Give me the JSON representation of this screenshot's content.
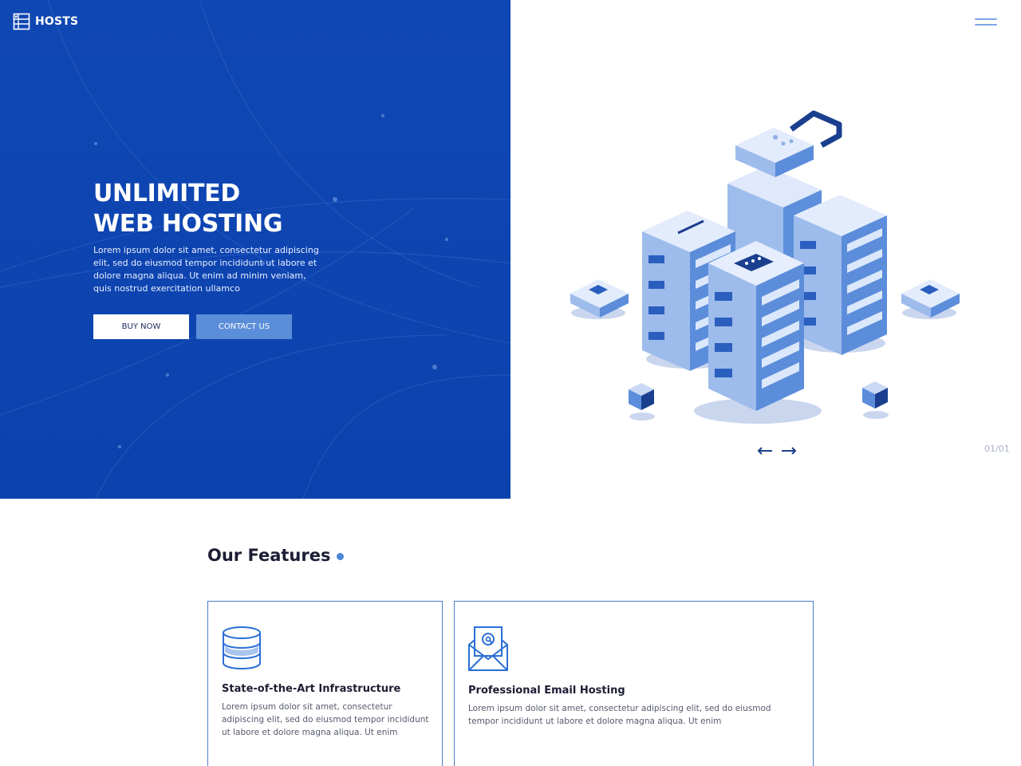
{
  "header": {
    "logo_text": "HOSTS",
    "logo_icon": "server-list-icon",
    "menu_icon": "hamburger-menu-icon"
  },
  "hero": {
    "title_line1": "UNLIMITED",
    "title_line2": "WEB HOSTING",
    "description": "Lorem ipsum dolor sit amet, consectetur adipiscing elit, sed do eiusmod tempor incididunt ut labore et dolore magna aliqua. Ut enim ad minim veniam, quis nostrud exercitation ullamco",
    "buy_label": "BUY NOW",
    "contact_label": "CONTACT US",
    "slide_counter": "01/01",
    "illustration": "isometric-server-racks-with-lock"
  },
  "features": {
    "heading": "Our Features",
    "cards": [
      {
        "icon": "database-icon",
        "title": "State-of-the-Art Infrastructure",
        "text": "Lorem ipsum dolor sit amet, consectetur adipiscing elit, sed do eiusmod tempor incididunt ut labore et dolore magna aliqua. Ut enim"
      },
      {
        "icon": "email-envelope-icon",
        "title": "Professional Email Hosting",
        "text": "Lorem ipsum dolor sit amet, consectetur adipiscing elit, sed do eiusmod tempor incididunt ut labore et dolore magna aliqua. Ut enim"
      }
    ]
  },
  "colors": {
    "hero_blue": "#0d44b0",
    "accent_blue": "#5b8ed9",
    "card_border": "#4a7ed0"
  }
}
